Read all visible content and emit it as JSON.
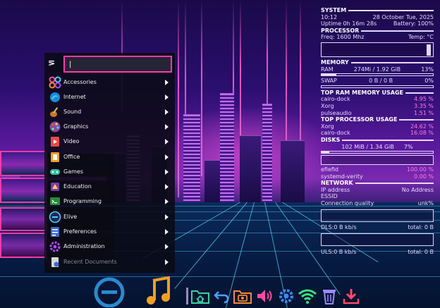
{
  "conky": {
    "system_title": "SYSTEM",
    "time": "10:12",
    "date": "28 October Tue, 2025",
    "uptime": "Uptime 0h 16m 28s",
    "battery": "Battery: 100%",
    "processor_title": "PROCESSOR",
    "freq": "Freq: 1600 Mhz",
    "temp": "Temp: °C",
    "memory_title": "MEMORY",
    "ram_label": "RAM",
    "ram_value": "274Mi / 1.92 GiB",
    "ram_pct": "13%",
    "ram_fraction": 0.13,
    "swap_label": "SWAP",
    "swap_value": "0 B / 0 B",
    "swap_pct": "0%",
    "top_ram_title": "TOP RAM MEMORY USAGE",
    "top_ram": [
      {
        "name": "cairo-dock",
        "pct": "4.95 %"
      },
      {
        "name": "Xorg",
        "pct": "3.35 %"
      },
      {
        "name": "pulseaudio",
        "pct": "1.51 %"
      }
    ],
    "top_proc_title": "TOP PROCESSOR USAGE",
    "top_proc": [
      {
        "name": "Xorg",
        "pct": "24.62 %"
      },
      {
        "name": "cairo-dock",
        "pct": "16.08 %"
      }
    ],
    "disks_title": "DISKS",
    "disk_value": "102 MiB / 1.34 GiB",
    "disk_pct": "7%",
    "disk_fraction": 0.07,
    "disk_rows": [
      {
        "name": "efiefid",
        "pct": "100.00 %"
      },
      {
        "name": "systemd-verity",
        "pct": "0.00 %"
      }
    ],
    "network_title": "NETWORK",
    "ip_label": "IP address",
    "ip_value": "No Address",
    "essid_label": "ESSID",
    "quality_label": "Connection quality",
    "quality_value": "unk%",
    "dls": "DLS:0 B kb/s",
    "dls_total": "total: 0 B",
    "uls": "ULS:0 B kb/s",
    "uls_total": "total: 0 B"
  },
  "menu": {
    "logo": "⋝",
    "search_value": "|",
    "items": [
      {
        "label": "Accessories",
        "icon": "accessories-icon"
      },
      {
        "label": "Internet",
        "icon": "internet-icon"
      },
      {
        "label": "Sound",
        "icon": "sound-icon"
      },
      {
        "label": "Graphics",
        "icon": "graphics-icon"
      },
      {
        "label": "Video",
        "icon": "video-icon"
      },
      {
        "label": "Office",
        "icon": "office-icon"
      },
      {
        "label": "Games",
        "icon": "games-icon"
      },
      {
        "label": "Education",
        "icon": "education-icon"
      },
      {
        "label": "Programming",
        "icon": "programming-icon"
      },
      {
        "label": "Elive",
        "icon": "elive-icon"
      },
      {
        "label": "Preferences",
        "icon": "preferences-icon"
      },
      {
        "label": "Administration",
        "icon": "administration-icon"
      },
      {
        "label": "Recent Documents",
        "icon": "recent-documents-icon"
      }
    ]
  },
  "dock": {
    "items": [
      "elive-launcher-icon",
      "music-icon",
      "home-folder-icon",
      "undo-icon",
      "screenshot-icon",
      "volume-icon",
      "settings-gear-icon",
      "wifi-icon",
      "trash-icon",
      "download-icon"
    ]
  }
}
